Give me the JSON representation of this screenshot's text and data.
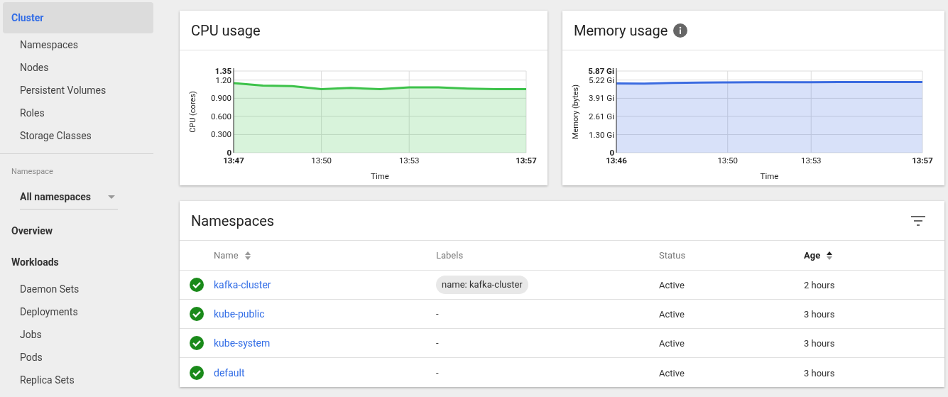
{
  "sidebar": {
    "top": [
      {
        "label": "Cluster",
        "selected": true,
        "children": [
          {
            "label": "Namespaces",
            "selected": false
          },
          {
            "label": "Nodes",
            "selected": false
          },
          {
            "label": "Persistent Volumes",
            "selected": false
          },
          {
            "label": "Roles",
            "selected": false
          },
          {
            "label": "Storage Classes",
            "selected": false
          }
        ]
      }
    ],
    "namespace_selector": {
      "label": "Namespace",
      "value": "All namespaces"
    },
    "bottom": [
      {
        "label": "Overview",
        "selected": false
      },
      {
        "label": "Workloads",
        "selected": false,
        "children": [
          {
            "label": "Daemon Sets",
            "selected": false
          },
          {
            "label": "Deployments",
            "selected": false
          },
          {
            "label": "Jobs",
            "selected": false
          },
          {
            "label": "Pods",
            "selected": false
          },
          {
            "label": "Replica Sets",
            "selected": false
          }
        ]
      }
    ]
  },
  "cpu_card": {
    "title": "CPU usage",
    "chart_data": {
      "type": "area",
      "xlabel": "Time",
      "ylabel": "CPU (cores)",
      "grid": true,
      "categories": [
        "13:47",
        null,
        null,
        "13:50",
        null,
        null,
        "13:53",
        null,
        null,
        null,
        "13:57"
      ],
      "series": [
        {
          "color": "#3dc24a",
          "values": [
            1.15,
            1.11,
            1.1,
            1.05,
            1.07,
            1.05,
            1.08,
            1.08,
            1.06,
            1.05,
            1.05
          ]
        }
      ],
      "ylim": [
        0,
        1.35
      ],
      "yticks": [
        {
          "value": 0,
          "label": "0"
        },
        {
          "value": 0.3,
          "label": "0.300"
        },
        {
          "value": 0.6,
          "label": "0.600"
        },
        {
          "value": 0.9,
          "label": "0.900"
        },
        {
          "value": 1.2,
          "label": "1.20"
        },
        {
          "value": 1.35,
          "label": "1.35"
        }
      ]
    }
  },
  "memory_card": {
    "title": "Memory usage",
    "chart_data": {
      "type": "area",
      "xlabel": "Time",
      "ylabel": "Memory (bytes)",
      "grid": true,
      "categories": [
        "13:46",
        null,
        null,
        null,
        "13:50",
        null,
        null,
        "13:53",
        null,
        null,
        null,
        "13:57"
      ],
      "series": [
        {
          "color": "#3b6be0",
          "values": [
            4.98,
            4.97,
            5.02,
            5.04,
            5.05,
            5.06,
            5.06,
            5.07,
            5.08,
            5.08,
            5.08,
            5.08
          ]
        }
      ],
      "ylim": [
        0,
        5.87
      ],
      "yticks": [
        {
          "value": 0,
          "label": "0"
        },
        {
          "value": 1.3,
          "label": "1.30 Gi"
        },
        {
          "value": 2.61,
          "label": "2.61 Gi"
        },
        {
          "value": 3.91,
          "label": "3.91 Gi"
        },
        {
          "value": 5.22,
          "label": "5.22 Gi"
        },
        {
          "value": 5.87,
          "label": "5.87 Gi"
        }
      ]
    }
  },
  "namespaces": {
    "title": "Namespaces",
    "columns": [
      {
        "label": "Name",
        "sorted": false
      },
      {
        "label": "Labels"
      },
      {
        "label": "Status"
      },
      {
        "label": "Age",
        "sorted": true
      }
    ],
    "rows": [
      {
        "name": "kafka-cluster",
        "labels": {
          "kind": "chips",
          "items": [
            "name: kafka-cluster"
          ]
        },
        "status": "Active",
        "age": "2 hours"
      },
      {
        "name": "kube-public",
        "labels": {
          "kind": "text",
          "text": "-"
        },
        "status": "Active",
        "age": "3 hours"
      },
      {
        "name": "kube-system",
        "labels": {
          "kind": "text",
          "text": "-"
        },
        "status": "Active",
        "age": "3 hours"
      },
      {
        "name": "default",
        "labels": {
          "kind": "text",
          "text": "-"
        },
        "status": "Active",
        "age": "3 hours"
      }
    ]
  }
}
